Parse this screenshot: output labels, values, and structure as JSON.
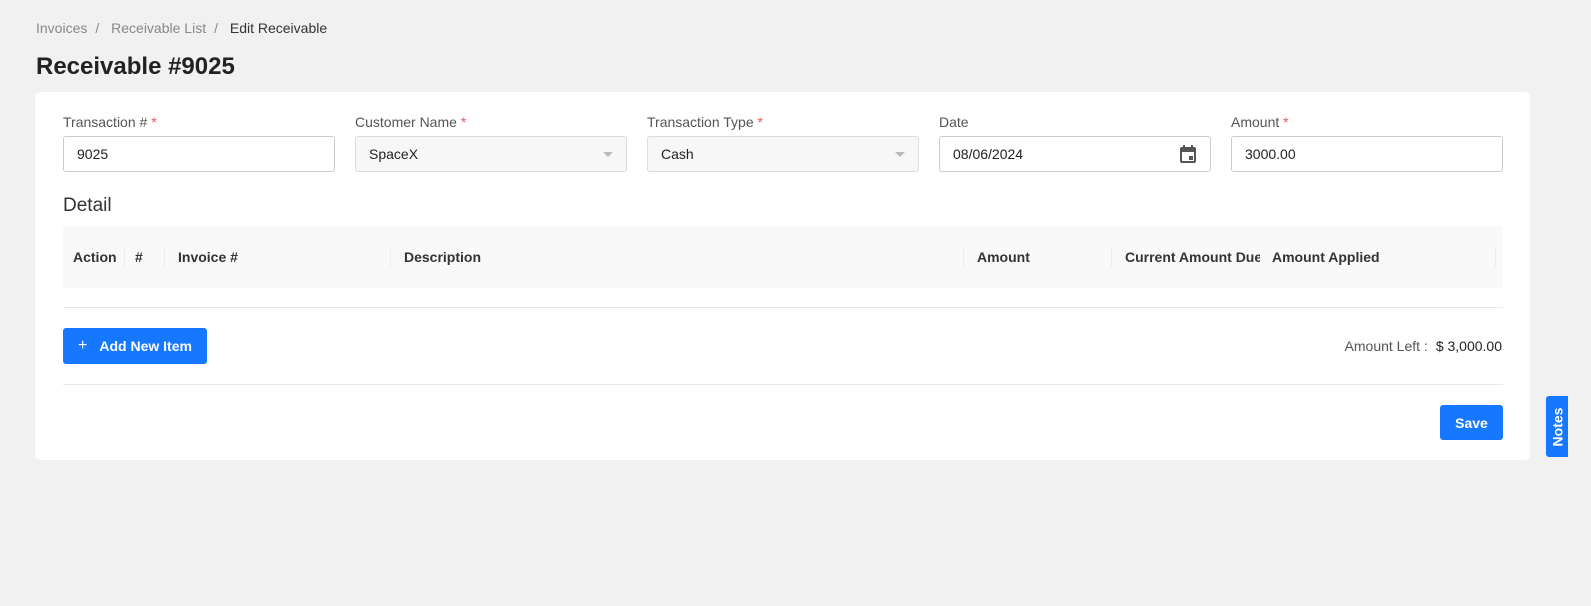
{
  "breadcrumb": [
    "Invoices",
    "Receivable List",
    "Edit Receivable"
  ],
  "title": "Receivable #9025",
  "form": {
    "transaction": {
      "label": "Transaction #",
      "value": "9025"
    },
    "customer": {
      "label": "Customer Name",
      "value": "SpaceX"
    },
    "type": {
      "label": "Transaction Type",
      "value": "Cash"
    },
    "date": {
      "label": "Date",
      "value": "08/06/2024"
    },
    "amount": {
      "label": "Amount",
      "value": "3000.00"
    },
    "required_mark": "*"
  },
  "detail": {
    "title": "Detail",
    "columns": [
      "Action",
      "#",
      "Invoice #",
      "Description",
      "Amount",
      "Current Amount Due",
      "Amount Applied"
    ]
  },
  "add_item": "Add New Item",
  "add_icon": "+",
  "amount_left": {
    "label": "Amount Left :",
    "value": "$ 3,000.00"
  },
  "save": "Save",
  "notes": "Notes",
  "colors": {
    "primary": "#1677ff",
    "required": "#ee5555"
  }
}
